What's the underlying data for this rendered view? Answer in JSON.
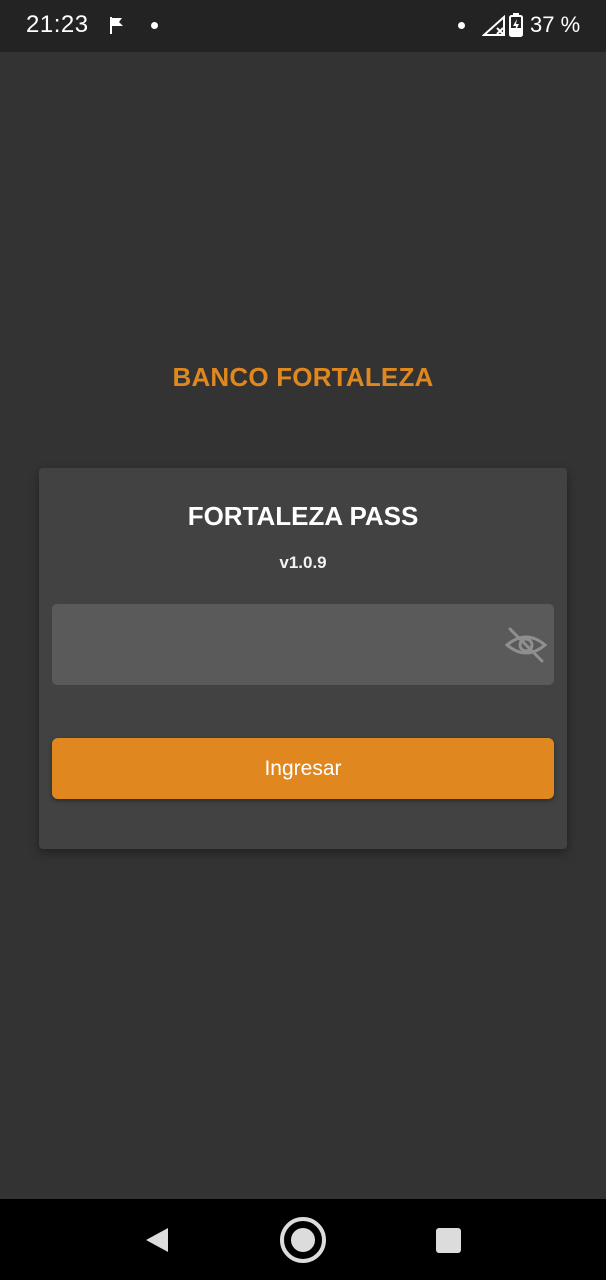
{
  "status_bar": {
    "time": "21:23",
    "battery_percent": "37 %",
    "icons": [
      "flag-icon",
      "notification-dot-icon",
      "signal-no-service-icon",
      "battery-charging-icon"
    ]
  },
  "bank": {
    "title": "BANCO FORTALEZA"
  },
  "card": {
    "title": "FORTALEZA PASS",
    "version": "v1.0.9",
    "pin_input": {
      "value": "",
      "placeholder": ""
    },
    "visibility_toggle_icon": "eye-off-icon",
    "login_button_label": "Ingresar"
  },
  "nav_bar": {
    "icons": [
      "back-icon",
      "home-icon",
      "recents-icon"
    ]
  },
  "colors": {
    "accent": "#E0881F",
    "background": "#333333",
    "card": "#424242",
    "input": "#5A5A5A"
  }
}
